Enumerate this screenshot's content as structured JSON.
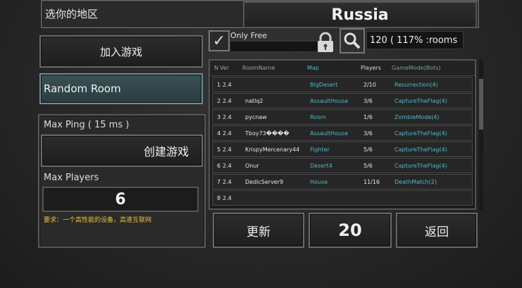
{
  "region": {
    "label": "选你的地区",
    "value": "Russia"
  },
  "left_panel": {
    "join_game": "加入游戏",
    "random_room": "Random Room",
    "max_ping_label": "Max Ping ( 15 ms )",
    "create_game": "创建游戏",
    "max_players_label": "Max Players",
    "max_players_value": "6",
    "requirement_note": "要求：一个高性能的设备，高速互联网"
  },
  "filters": {
    "only_free_label": "Only Free",
    "check_mark": "✓",
    "room_count": "120 ( 117% :rooms"
  },
  "icons": {
    "lock": "lock-icon",
    "search": "search-icon"
  },
  "table": {
    "headers": [
      "N",
      "Ver",
      "RoomName",
      "Map",
      "Players",
      "GameMode(Bots)"
    ],
    "rows": [
      [
        "1",
        "2.4",
        "",
        "BigDesert",
        "2/10",
        "Resurrection(4)"
      ],
      [
        "2",
        "2.4",
        "natlq2",
        "AssaultHouse",
        "3/6",
        "CaptureTheFlag(4)"
      ],
      [
        "3",
        "2.4",
        "pycnaw",
        "Room",
        "1/6",
        "ZombieMode(4)"
      ],
      [
        "4",
        "2.4",
        "Tboy73����",
        "AssaultHouse",
        "3/6",
        "CaptureTheFlag(4)"
      ],
      [
        "5",
        "2.4",
        "KrispyMercenary44",
        "Fighter",
        "5/6",
        "CaptureTheFlag(4)"
      ],
      [
        "6",
        "2.4",
        "Onur",
        "Desert4",
        "5/6",
        "CaptureTheFlag(4)"
      ],
      [
        "7",
        "2.4",
        "DedicServer9",
        "House",
        "11/16",
        "DeathMatch(2)"
      ],
      [
        "8",
        "2.4",
        "",
        "",
        "",
        ""
      ]
    ]
  },
  "bottom": {
    "refresh": "更新",
    "page_size": "20",
    "back": "返回"
  },
  "colors": {
    "map_text": "#53b6c9",
    "note_text": "#e3c23a"
  }
}
